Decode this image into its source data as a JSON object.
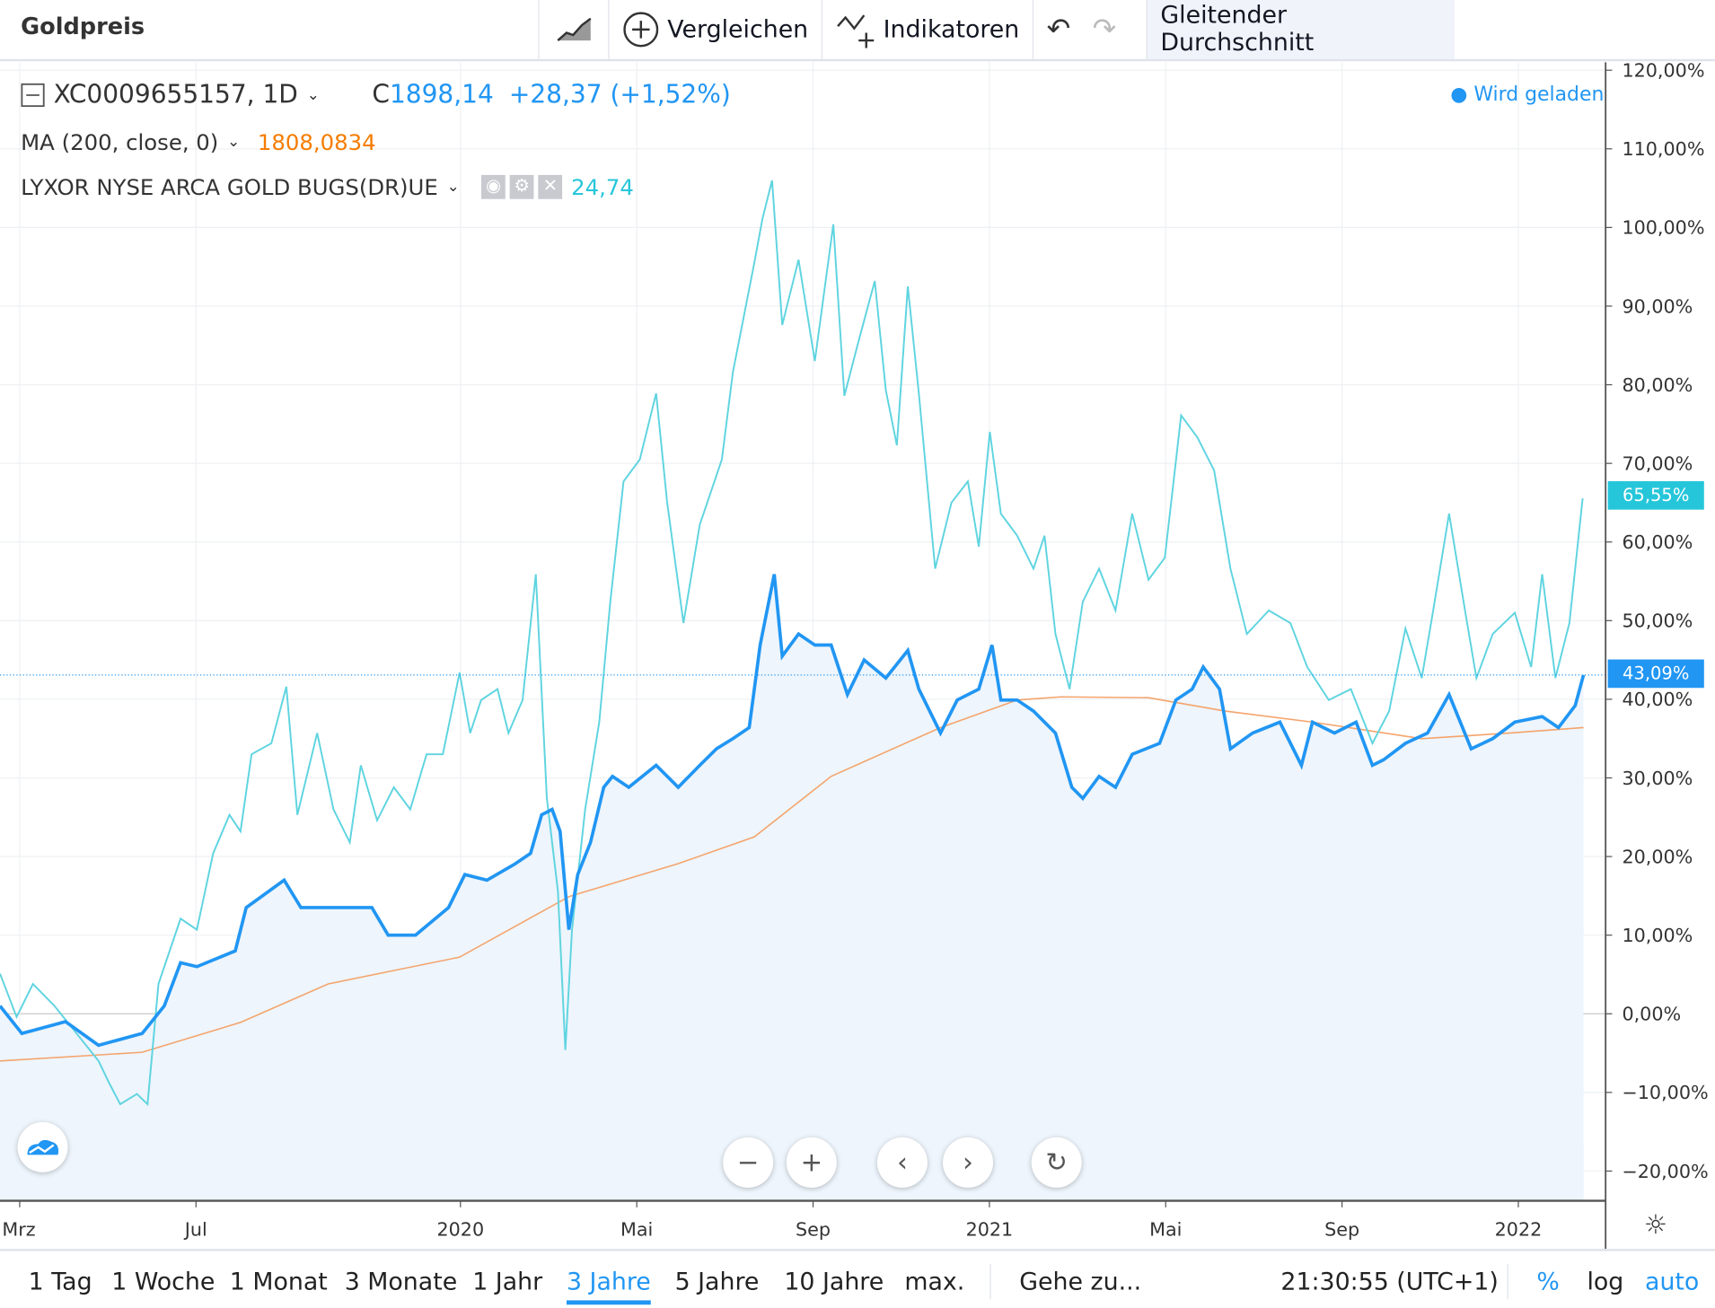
{
  "header": {
    "title": "Goldpreis",
    "compare": "Vergleichen",
    "indicators": "Indikatoren",
    "active_indicator": "Gleitender Durchschnitt"
  },
  "legend": {
    "symbol": "XC0009655157, 1D",
    "close_prefix": "C",
    "close": "1898,14",
    "change": "+28,37 (+1,52%)",
    "loading": "Wird geladen",
    "ma_label": "MA (200, close, 0)",
    "ma_value": "1808,0834",
    "compare_label": "LYXOR NYSE ARCA GOLD BUGS(DR)UE",
    "compare_value": "24,74"
  },
  "colors": {
    "gold": "#2196f3",
    "gdx": "#5fd4e0",
    "ma": "#f4a46c",
    "ma_text": "#f57c00",
    "gdx_text": "#26c6da",
    "fill": "#eef5fc"
  },
  "tags": {
    "gdx": "65,55%",
    "gold": "43,09%"
  },
  "bottom": {
    "ranges": [
      "1 Tag",
      "1 Woche",
      "1 Monat",
      "3 Monate",
      "1 Jahr",
      "3 Jahre",
      "5 Jahre",
      "10 Jahre",
      "max."
    ],
    "active_range": "3 Jahre",
    "goto": "Gehe zu...",
    "time": "21:30:55 (UTC+1)",
    "percent": "%",
    "log": "log",
    "auto": "auto"
  },
  "chart_data": {
    "type": "line",
    "x_unit": "months since Mar 2019",
    "xticks": [
      {
        "m": 0,
        "label": "Mrz"
      },
      {
        "m": 4,
        "label": "Jul"
      },
      {
        "m": 10,
        "label": "2020"
      },
      {
        "m": 14,
        "label": "Mai"
      },
      {
        "m": 18,
        "label": "Sep"
      },
      {
        "m": 22,
        "label": "2021"
      },
      {
        "m": 26,
        "label": "Mai"
      },
      {
        "m": 30,
        "label": "Sep"
      },
      {
        "m": 34,
        "label": "2022"
      }
    ],
    "yticks": [
      120,
      110,
      100,
      90,
      80,
      70,
      60,
      50,
      40,
      30,
      20,
      10,
      0,
      -10,
      -20
    ],
    "ytick_labels": [
      "120,00%",
      "110,00%",
      "100,00%",
      "90,00%",
      "80,00%",
      "70,00%",
      "60,00%",
      "50,00%",
      "40,00%",
      "30,00%",
      "20,00%",
      "10,00%",
      "0,00%",
      "−10,00%",
      "−20,00%"
    ],
    "ylim": [
      -24,
      121
    ],
    "series": [
      {
        "name": "Goldpreis",
        "values": [
          [
            -0.45,
            1
          ],
          [
            0.05,
            -2.5
          ],
          [
            1.04,
            -1
          ],
          [
            1.79,
            -4
          ],
          [
            2.78,
            -2.5
          ],
          [
            3.28,
            1
          ],
          [
            3.65,
            6.5
          ],
          [
            4.02,
            6
          ],
          [
            4.89,
            8
          ],
          [
            5.14,
            13.5
          ],
          [
            6,
            17
          ],
          [
            6.38,
            13.5
          ],
          [
            7,
            13.5
          ],
          [
            7.99,
            13.5
          ],
          [
            8.36,
            10
          ],
          [
            8.98,
            10
          ],
          [
            9.73,
            13.5
          ],
          [
            10.1,
            17.7
          ],
          [
            10.6,
            17
          ],
          [
            11.22,
            19
          ],
          [
            11.59,
            20.4
          ],
          [
            11.84,
            25.3
          ],
          [
            12.08,
            26
          ],
          [
            12.26,
            23.2
          ],
          [
            12.46,
            10.7
          ],
          [
            12.66,
            17.7
          ],
          [
            12.95,
            21.8
          ],
          [
            13.25,
            28.8
          ],
          [
            13.45,
            30.2
          ],
          [
            13.82,
            28.8
          ],
          [
            14.44,
            31.6
          ],
          [
            14.94,
            28.8
          ],
          [
            15.43,
            31.6
          ],
          [
            15.81,
            33.7
          ],
          [
            16.18,
            35
          ],
          [
            16.55,
            36.4
          ],
          [
            16.8,
            46.9
          ],
          [
            17.12,
            55.9
          ],
          [
            17.3,
            45.5
          ],
          [
            17.67,
            48.3
          ],
          [
            18.04,
            46.9
          ],
          [
            18.41,
            46.9
          ],
          [
            18.78,
            40.6
          ],
          [
            19.16,
            45
          ],
          [
            19.65,
            42.7
          ],
          [
            20.15,
            46.2
          ],
          [
            20.4,
            41.3
          ],
          [
            20.89,
            35.7
          ],
          [
            21.27,
            39.9
          ],
          [
            21.76,
            41.3
          ],
          [
            22.06,
            46.9
          ],
          [
            22.26,
            39.9
          ],
          [
            22.63,
            39.9
          ],
          [
            23,
            38.5
          ],
          [
            23.5,
            35.7
          ],
          [
            23.87,
            28.8
          ],
          [
            24.12,
            27.4
          ],
          [
            24.49,
            30.2
          ],
          [
            24.86,
            28.8
          ],
          [
            25.24,
            33
          ],
          [
            25.86,
            34.4
          ],
          [
            26.23,
            39.9
          ],
          [
            26.6,
            41.3
          ],
          [
            26.85,
            44.1
          ],
          [
            27.22,
            41.3
          ],
          [
            27.47,
            33.7
          ],
          [
            27.97,
            35.7
          ],
          [
            28.59,
            37.1
          ],
          [
            29.08,
            31.6
          ],
          [
            29.33,
            37.1
          ],
          [
            29.83,
            35.7
          ],
          [
            30.32,
            37.1
          ],
          [
            30.69,
            31.6
          ],
          [
            30.94,
            32.3
          ],
          [
            31.44,
            34.4
          ],
          [
            31.94,
            35.7
          ],
          [
            32.43,
            40.6
          ],
          [
            32.93,
            33.7
          ],
          [
            33.42,
            35
          ],
          [
            33.92,
            37.1
          ],
          [
            34.54,
            37.8
          ],
          [
            34.91,
            36.4
          ],
          [
            35.29,
            39.2
          ],
          [
            35.48,
            43.09
          ]
        ]
      },
      {
        "name": "LYXOR NYSE ARCA GOLD BUGS(DR)UE",
        "values": [
          [
            -0.45,
            5.1
          ],
          [
            -0.07,
            -0.4
          ],
          [
            0.3,
            3.8
          ],
          [
            0.79,
            1
          ],
          [
            1.29,
            -2.5
          ],
          [
            1.79,
            -6
          ],
          [
            2.03,
            -8.8
          ],
          [
            2.28,
            -11.5
          ],
          [
            2.66,
            -10.2
          ],
          [
            2.9,
            -11.5
          ],
          [
            3.15,
            3.8
          ],
          [
            3.65,
            12.1
          ],
          [
            4.02,
            10.7
          ],
          [
            4.39,
            20.4
          ],
          [
            4.76,
            25.3
          ],
          [
            5.01,
            23.2
          ],
          [
            5.26,
            33
          ],
          [
            5.71,
            34.4
          ],
          [
            6.05,
            41.6
          ],
          [
            6.3,
            25.3
          ],
          [
            6.75,
            35.7
          ],
          [
            7.12,
            26
          ],
          [
            7.49,
            21.8
          ],
          [
            7.74,
            31.6
          ],
          [
            8.11,
            24.6
          ],
          [
            8.49,
            28.8
          ],
          [
            8.86,
            26
          ],
          [
            9.23,
            33
          ],
          [
            9.6,
            33
          ],
          [
            9.98,
            43.4
          ],
          [
            10.22,
            35.7
          ],
          [
            10.47,
            39.9
          ],
          [
            10.84,
            41.3
          ],
          [
            11.09,
            35.7
          ],
          [
            11.41,
            39.9
          ],
          [
            11.71,
            55.9
          ],
          [
            11.96,
            27.4
          ],
          [
            12.21,
            15.6
          ],
          [
            12.38,
            -4.6
          ],
          [
            12.53,
            10.7
          ],
          [
            12.83,
            26
          ],
          [
            13.15,
            37.1
          ],
          [
            13.4,
            52.4
          ],
          [
            13.7,
            67.7
          ],
          [
            14.07,
            70.5
          ],
          [
            14.44,
            78.9
          ],
          [
            14.69,
            65
          ],
          [
            15.06,
            49.7
          ],
          [
            15.43,
            62.2
          ],
          [
            15.93,
            70.5
          ],
          [
            16.18,
            81.6
          ],
          [
            16.67,
            95.6
          ],
          [
            16.85,
            101.1
          ],
          [
            17.07,
            106
          ],
          [
            17.3,
            87.6
          ],
          [
            17.67,
            95.9
          ],
          [
            18.04,
            83
          ],
          [
            18.46,
            100.4
          ],
          [
            18.71,
            78.6
          ],
          [
            19.03,
            85.5
          ],
          [
            19.4,
            93.2
          ],
          [
            19.65,
            79.3
          ],
          [
            19.9,
            72.3
          ],
          [
            20.15,
            92.5
          ],
          [
            20.4,
            78.9
          ],
          [
            20.77,
            56.6
          ],
          [
            21.14,
            65
          ],
          [
            21.51,
            67.7
          ],
          [
            21.76,
            59.4
          ],
          [
            22.01,
            74
          ],
          [
            22.26,
            63.6
          ],
          [
            22.63,
            60.8
          ],
          [
            23,
            56.6
          ],
          [
            23.25,
            60.8
          ],
          [
            23.5,
            48.3
          ],
          [
            23.82,
            41.3
          ],
          [
            24.12,
            52.4
          ],
          [
            24.49,
            56.6
          ],
          [
            24.86,
            51.3
          ],
          [
            25.24,
            63.6
          ],
          [
            25.61,
            55.2
          ],
          [
            25.98,
            58
          ],
          [
            26.35,
            76.1
          ],
          [
            26.72,
            73.3
          ],
          [
            27.1,
            69.1
          ],
          [
            27.47,
            56.6
          ],
          [
            27.84,
            48.3
          ],
          [
            28.34,
            51.3
          ],
          [
            28.83,
            49.7
          ],
          [
            29.21,
            44.1
          ],
          [
            29.7,
            39.9
          ],
          [
            30.2,
            41.3
          ],
          [
            30.69,
            34.4
          ],
          [
            31.07,
            38.5
          ],
          [
            31.44,
            49
          ],
          [
            31.81,
            42.7
          ],
          [
            32.06,
            51
          ],
          [
            32.43,
            63.6
          ],
          [
            32.8,
            51
          ],
          [
            33.05,
            42.7
          ],
          [
            33.42,
            48.3
          ],
          [
            33.92,
            51
          ],
          [
            34.29,
            44.1
          ],
          [
            34.54,
            55.9
          ],
          [
            34.84,
            42.7
          ],
          [
            35.16,
            49.7
          ],
          [
            35.46,
            65.55
          ]
        ]
      },
      {
        "name": "MA (200, close, 0)",
        "values": [
          [
            -0.45,
            -6
          ],
          [
            2.78,
            -4.9
          ],
          [
            5.01,
            -1.1
          ],
          [
            7,
            3.8
          ],
          [
            9.98,
            7.2
          ],
          [
            12.46,
            14.9
          ],
          [
            14.94,
            19.1
          ],
          [
            16.67,
            22.5
          ],
          [
            18.41,
            30.2
          ],
          [
            20.89,
            36.4
          ],
          [
            22.63,
            39.9
          ],
          [
            23.62,
            40.3
          ],
          [
            25.61,
            40.2
          ],
          [
            27.35,
            38.5
          ],
          [
            29.33,
            37.1
          ],
          [
            31.81,
            35
          ],
          [
            33.8,
            35.7
          ],
          [
            35.48,
            36.4
          ]
        ]
      }
    ],
    "reference_line": 43.09,
    "grid": true
  }
}
